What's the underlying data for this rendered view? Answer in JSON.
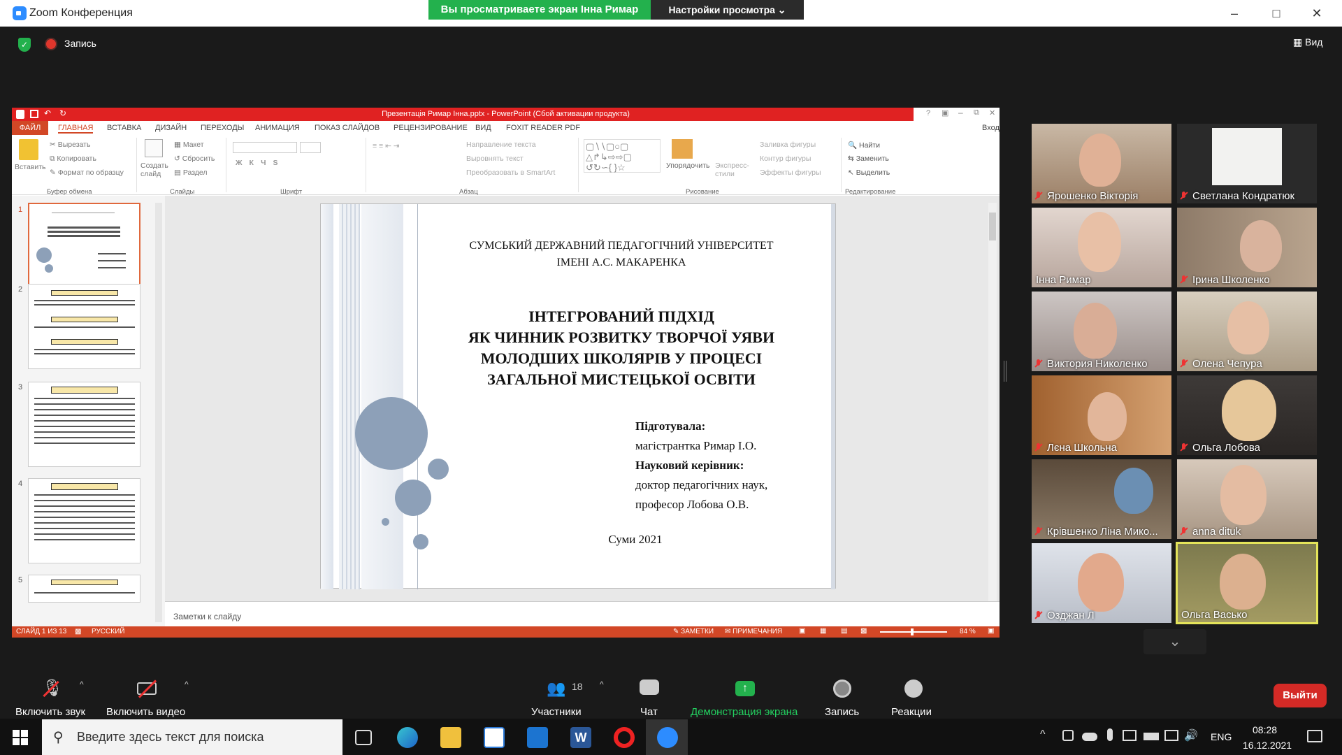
{
  "zoom": {
    "window_title": "Zoom Конференция",
    "viewing_banner": "Вы просматриваете экран Інна Римар",
    "view_options": "Настройки просмотра ⌄",
    "recording_label": "Запись",
    "view_button": "Вид"
  },
  "ppt": {
    "title": "Презентація Римар Інна.pptx - PowerPoint (Сбой активации продукта)",
    "menu": [
      "ФАЙЛ",
      "ГЛАВНАЯ",
      "ВСТАВКА",
      "ДИЗАЙН",
      "ПЕРЕХОДЫ",
      "АНИМАЦИЯ",
      "ПОКАЗ СЛАЙДОВ",
      "РЕЦЕНЗИРОВАНИЕ",
      "ВИД",
      "FOXIT READER PDF"
    ],
    "login": "Вход",
    "ribbon": {
      "paste": "Вставить",
      "cut": "Вырезать",
      "copy": "Копировать",
      "format_painter": "Формат по образцу",
      "clipboard_group": "Буфер обмена",
      "create_slide": "Создать слайд",
      "layout": "Макет",
      "reset": "Сбросить",
      "section": "Раздел",
      "slides_group": "Слайды",
      "font_group": "Шрифт",
      "text_direction": "Направление текста",
      "align_text": "Выровнять текст",
      "smartart": "Преобразовать в SmartArt",
      "paragraph_group": "Абзац",
      "arrange": "Упорядочить",
      "quick_styles": "Экспресс-стили",
      "shape_fill": "Заливка фигуры",
      "shape_outline": "Контур фигуры",
      "shape_effects": "Эффекты фигуры",
      "drawing_group": "Рисование",
      "find": "Найти",
      "replace": "Заменить",
      "select": "Выделить",
      "editing_group": "Редактирование"
    },
    "thumbs": [
      {
        "num": "1",
        "heading": ""
      },
      {
        "num": "2",
        "heading": "Мета дослідження:"
      },
      {
        "num": "3",
        "heading": "Методи дослідження:"
      },
      {
        "num": "4",
        "heading": "Завдання дослідження:"
      },
      {
        "num": "5",
        "heading": "Кутолюрна стаття № 3"
      }
    ],
    "slide": {
      "university_line1": "СУМСЬКИЙ ДЕРЖАВНИЙ ПЕДАГОГІЧНИЙ УНІВЕРСИТЕТ",
      "university_line2": "ІМЕНІ А.С. МАКАРЕНКА",
      "title_lines": [
        "ІНТЕГРОВАНИЙ ПІДХІД",
        "ЯК ЧИННИК РОЗВИТКУ ТВОРЧОЇ УЯВИ",
        "МОЛОДШИХ ШКОЛЯРІВ У ПРОЦЕСІ",
        "ЗАГАЛЬНОЇ МИСТЕЦЬКОЇ ОСВІТИ"
      ],
      "prepared_label": "Підготувала:",
      "prepared_by": "магістрантка Римар І.О.",
      "supervisor_label": "Науковий керівник:",
      "supervisor_line1": "доктор педагогічних наук,",
      "supervisor_line2": "професор Лобова О.В.",
      "city_year": "Суми 2021"
    },
    "notes_placeholder": "Заметки к слайду",
    "status": {
      "slide_of": "СЛАЙД 1 ИЗ 13",
      "language": "РУССКИЙ",
      "notes": "ЗАМЕТКИ",
      "comments": "ПРИМЕЧАНИЯ",
      "zoom": "84 %"
    }
  },
  "participants": [
    {
      "name": "Ярошенко Вікторія",
      "muted": true
    },
    {
      "name": "Светлана Кондратюк",
      "muted": true
    },
    {
      "name": "Інна Римар",
      "muted": false
    },
    {
      "name": "Ірина Школенко",
      "muted": true
    },
    {
      "name": "Виктория Николенко",
      "muted": true
    },
    {
      "name": "Олена Чепура",
      "muted": true
    },
    {
      "name": "Лєна Школьна",
      "muted": true
    },
    {
      "name": "Ольга Лобова",
      "muted": true
    },
    {
      "name": "Крівшенко Ліна Мико...",
      "muted": true
    },
    {
      "name": "anna dituk",
      "muted": true
    },
    {
      "name": "Озджан Л",
      "muted": true
    },
    {
      "name": "Ольга Васько",
      "muted": false
    }
  ],
  "bottom": {
    "unmute": "Включить звук",
    "start_video": "Включить видео",
    "participants_label": "Участники",
    "participants_count": "18",
    "chat": "Чат",
    "share": "Демонстрация экрана",
    "record": "Запись",
    "reactions": "Реакции",
    "leave": "Выйти"
  },
  "taskbar": {
    "search_placeholder": "Введите здесь текст для поиска",
    "language": "ENG",
    "time": "08:28",
    "date": "16.12.2021"
  },
  "colors": {
    "zoom_green": "#23b14d",
    "ppt_red": "#d24726",
    "leave_red": "#d42a26",
    "active_speaker": "#e4e45a"
  }
}
